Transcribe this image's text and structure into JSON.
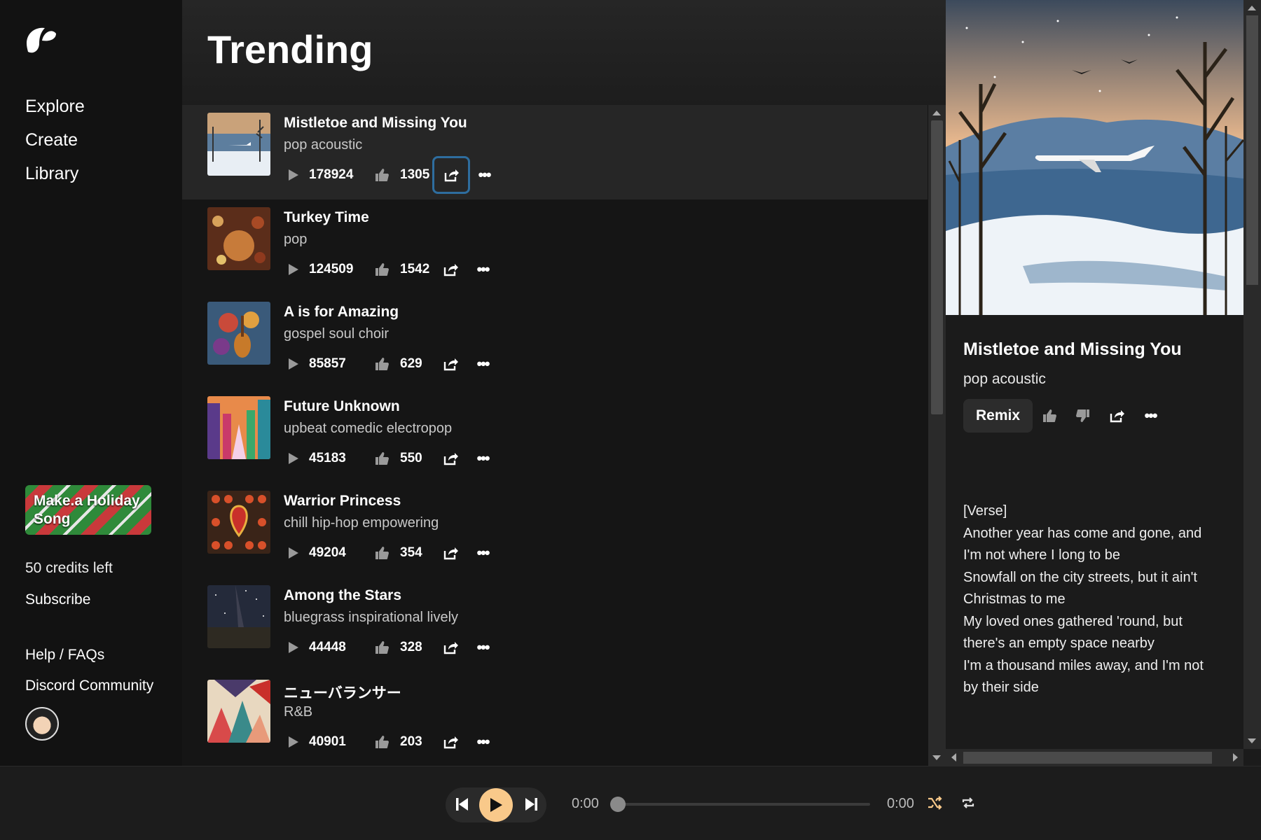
{
  "sidebar": {
    "nav": [
      "Explore",
      "Create",
      "Library"
    ],
    "promo": "Make.a Holiday Song",
    "credits": "50 credits left",
    "subscribe": "Subscribe",
    "help": "Help / FAQs",
    "discord": "Discord Community"
  },
  "main": {
    "title": "Trending",
    "songs": [
      {
        "title": "Mistletoe and Missing You",
        "style": "pop acoustic",
        "plays": "178924",
        "likes": "1305"
      },
      {
        "title": "Turkey Time",
        "style": "pop",
        "plays": "124509",
        "likes": "1542"
      },
      {
        "title": "A is for Amazing",
        "style": "gospel soul choir",
        "plays": "85857",
        "likes": "629"
      },
      {
        "title": "Future Unknown",
        "style": "upbeat comedic electropop",
        "plays": "45183",
        "likes": "550"
      },
      {
        "title": "Warrior Princess",
        "style": "chill hip-hop empowering",
        "plays": "49204",
        "likes": "354"
      },
      {
        "title": "Among the Stars",
        "style": "bluegrass inspirational lively",
        "plays": "44448",
        "likes": "328"
      },
      {
        "title": "ニューバランサー",
        "style": "R&B",
        "plays": "40901",
        "likes": "203"
      }
    ]
  },
  "panel": {
    "title": "Mistletoe and Missing You",
    "style": "pop acoustic",
    "remix": "Remix",
    "lyrics": [
      "[Verse]",
      "Another year has come and gone, and",
      "I'm not where I long to be",
      "Snowfall on the city streets, but it ain't",
      "Christmas to me",
      "My loved ones gathered 'round, but",
      "there's an empty space nearby",
      "I'm a thousand miles away, and I'm not",
      "by their side"
    ]
  },
  "player": {
    "time_start": "0:00",
    "time_end": "0:00",
    "progress": 0,
    "accent": "#f9c98a"
  }
}
